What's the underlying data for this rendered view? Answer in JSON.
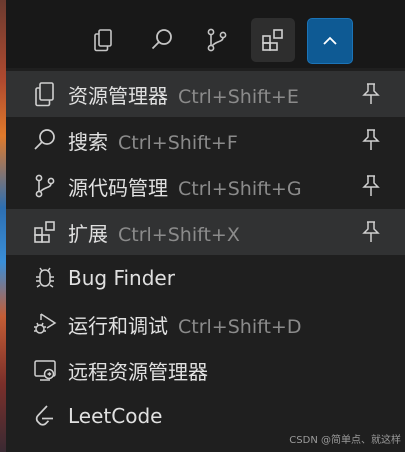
{
  "activity_bar": {
    "buttons": [
      {
        "name": "explorer",
        "icon": "files-icon"
      },
      {
        "name": "search",
        "icon": "search-icon"
      },
      {
        "name": "source-control",
        "icon": "source-control-icon"
      },
      {
        "name": "extensions",
        "icon": "extensions-icon",
        "state": "active"
      },
      {
        "name": "expand",
        "icon": "chevron-up-icon",
        "state": "primary"
      }
    ]
  },
  "menu": {
    "items": [
      {
        "label": "资源管理器",
        "shortcut": "Ctrl+Shift+E",
        "icon": "files-icon",
        "pinnable": true
      },
      {
        "label": "搜索",
        "shortcut": "Ctrl+Shift+F",
        "icon": "search-icon",
        "pinnable": true
      },
      {
        "label": "源代码管理",
        "shortcut": "Ctrl+Shift+G",
        "icon": "source-control-icon",
        "pinnable": true
      },
      {
        "label": "扩展",
        "shortcut": "Ctrl+Shift+X",
        "icon": "extensions-icon",
        "pinnable": true
      },
      {
        "label": "Bug Finder",
        "shortcut": "",
        "icon": "bug-icon",
        "pinnable": false
      },
      {
        "label": "运行和调试",
        "shortcut": "Ctrl+Shift+D",
        "icon": "run-debug-icon",
        "pinnable": false
      },
      {
        "label": "远程资源管理器",
        "shortcut": "",
        "icon": "remote-explorer-icon",
        "pinnable": false
      },
      {
        "label": "LeetCode",
        "shortcut": "",
        "icon": "leetcode-icon",
        "pinnable": false
      }
    ]
  },
  "watermark": "CSDN @简单点、就这样",
  "colors": {
    "accent": "#0e5a94",
    "hover": "#313233",
    "menu_bg": "#1f1f1f"
  }
}
